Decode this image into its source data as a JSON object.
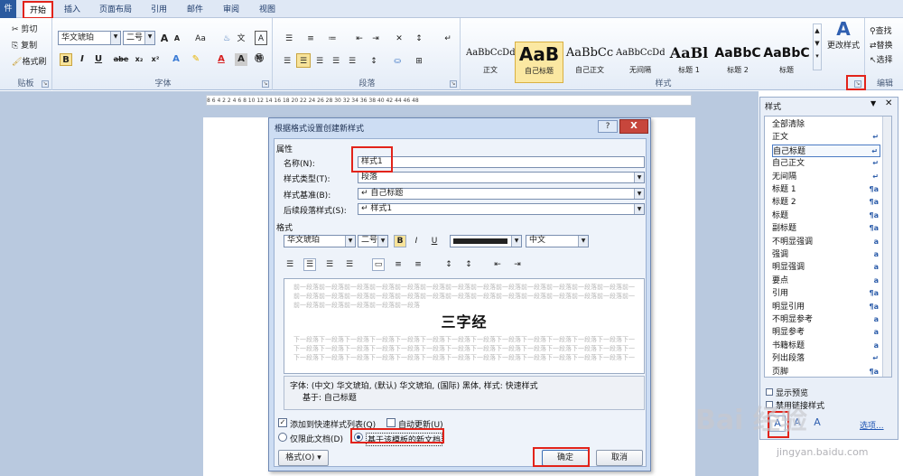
{
  "tabs": {
    "file": "件",
    "home": "开始",
    "insert": "插入",
    "layout": "页面布局",
    "references": "引用",
    "mailings": "邮件",
    "review": "审阅",
    "view": "视图"
  },
  "clipboard": {
    "cut": "剪切",
    "copy": "复制",
    "painter": "格式刷",
    "label": "贴板"
  },
  "font": {
    "name": "华文琥珀",
    "size": "二号",
    "label": "字体",
    "grow": "A",
    "shrink": "A",
    "aa": "Aa",
    "bold": "B",
    "italic": "I",
    "underline": "U",
    "strike": "abe",
    "sub": "x₂",
    "sup": "x²"
  },
  "paragraph": {
    "label": "段落"
  },
  "styles": {
    "label": "样式",
    "change": "更改样式",
    "items": [
      {
        "sample": "AaBbCcDd",
        "name": "正文"
      },
      {
        "sample": "AaB",
        "name": "自己标题"
      },
      {
        "sample": "AaBbCc",
        "name": "自己正文"
      },
      {
        "sample": "AaBbCcDd",
        "name": "无间隔"
      },
      {
        "sample": "AaBl",
        "name": "标题 1"
      },
      {
        "sample": "AaBbC",
        "name": "标题 2"
      },
      {
        "sample": "AaBbC",
        "name": "标题"
      }
    ]
  },
  "editing": {
    "label": "编辑",
    "find": "查找",
    "replace": "替换",
    "select": "选择"
  },
  "ruler": {
    "text": "8 6 4 2 2 4 6 8 10 12 14 16 18 20 22 24 26 28 30 32 34 36 38 40 42 44 46 48"
  },
  "dialog": {
    "title": "根据格式设置创建新样式",
    "help": "?",
    "close": "X",
    "props_label": "属性",
    "name_label": "名称(N):",
    "name_value": "样式1",
    "type_label": "样式类型(T):",
    "type_value": "段落",
    "base_label": "样式基准(B):",
    "base_value": "↵ 自己标题",
    "next_label": "后续段落样式(S):",
    "next_value": "↵ 样式1",
    "format_label": "格式",
    "fmt_font": "华文琥珀",
    "fmt_size": "二号",
    "fmt_bold": "B",
    "fmt_italic": "I",
    "fmt_underline": "U",
    "fmt_lang": "中文",
    "preview_prev": "前一段落前一段落前一段落前一段落前一段落前一段落前一段落前一段落前一段落前一段落前一段落前一段落前一段落前一段落",
    "preview_text": "三字经",
    "preview_next": "下一段落下一段落下一段落下一段落下一段落下一段落下一段落下一段落下一段落下一段落下一段落下一段落下一段落下一段落",
    "desc_line1": "字体: (中文) 华文琥珀, (默认) 华文琥珀, (国际) 黑体, 样式: 快速样式",
    "desc_line2": "基于: 自己标题",
    "add_quick": "添加到快速样式列表(Q)",
    "auto_update": "自动更新(U)",
    "this_doc": "仅限此文档(D)",
    "new_docs": "基于该模板的新文档",
    "format_btn": "格式(O) ▾",
    "ok": "确定",
    "cancel": "取消"
  },
  "pane": {
    "title": "样式",
    "items": [
      {
        "name": "全部清除",
        "mark": ""
      },
      {
        "name": "正文",
        "mark": "↵"
      },
      {
        "name": "自己标题",
        "mark": "↵"
      },
      {
        "name": "自己正文",
        "mark": "↵"
      },
      {
        "name": "无间隔",
        "mark": "↵"
      },
      {
        "name": "标题 1",
        "mark": "¶a"
      },
      {
        "name": "标题 2",
        "mark": "¶a"
      },
      {
        "name": "标题",
        "mark": "¶a"
      },
      {
        "name": "副标题",
        "mark": "¶a"
      },
      {
        "name": "不明显强调",
        "mark": "a"
      },
      {
        "name": "强调",
        "mark": "a"
      },
      {
        "name": "明显强调",
        "mark": "a"
      },
      {
        "name": "要点",
        "mark": "a"
      },
      {
        "name": "引用",
        "mark": "¶a"
      },
      {
        "name": "明显引用",
        "mark": "¶a"
      },
      {
        "name": "不明显参考",
        "mark": "a"
      },
      {
        "name": "明显参考",
        "mark": "a"
      },
      {
        "name": "书籍标题",
        "mark": "a"
      },
      {
        "name": "列出段落",
        "mark": "↵"
      },
      {
        "name": "页脚",
        "mark": "¶a"
      }
    ],
    "show_preview": "显示预览",
    "disable_linked": "禁用链接样式",
    "options": "选项..."
  },
  "watermark": {
    "brand": "Bai 经验",
    "url": "jingyan.baidu.com"
  }
}
